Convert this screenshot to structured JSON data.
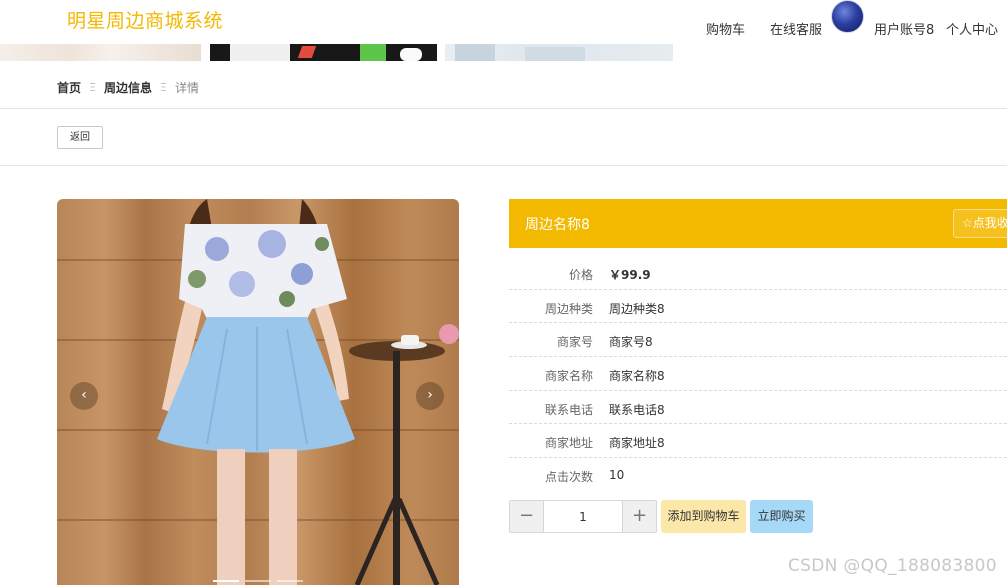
{
  "header": {
    "logo": "明星周边商城系统",
    "nav": {
      "cart": "购物车",
      "service": "在线客服",
      "account": "用户账号8",
      "center": "个人中心"
    }
  },
  "breadcrumb": {
    "home": "首页",
    "section": "周边信息",
    "current": "详情",
    "separator": "Ξ"
  },
  "back_label": "返回",
  "carousel": {
    "prev_glyph": "‹",
    "next_glyph": "›",
    "slide_count": 3,
    "active_slide": 1
  },
  "product": {
    "title": "周边名称8",
    "favorite_label": "☆点我收",
    "fields": [
      {
        "label": "价格",
        "value": "￥99.9"
      },
      {
        "label": "周边种类",
        "value": "周边种类8"
      },
      {
        "label": "商家号",
        "value": "商家号8"
      },
      {
        "label": "商家名称",
        "value": "商家名称8"
      },
      {
        "label": "联系电话",
        "value": "联系电话8"
      },
      {
        "label": "商家地址",
        "value": "商家地址8"
      },
      {
        "label": "点击次数",
        "value": "10"
      }
    ]
  },
  "quantity": {
    "value": "1",
    "minus_glyph": "−",
    "plus_glyph": "+"
  },
  "actions": {
    "add_to_cart": "添加到购物车",
    "buy_now": "立即购买"
  },
  "watermark": "CSDN @QQ_188083800",
  "colors": {
    "brand": "#f3b800",
    "cart_button": "#fbe7a8",
    "buy_button": "#a6d9f7"
  }
}
